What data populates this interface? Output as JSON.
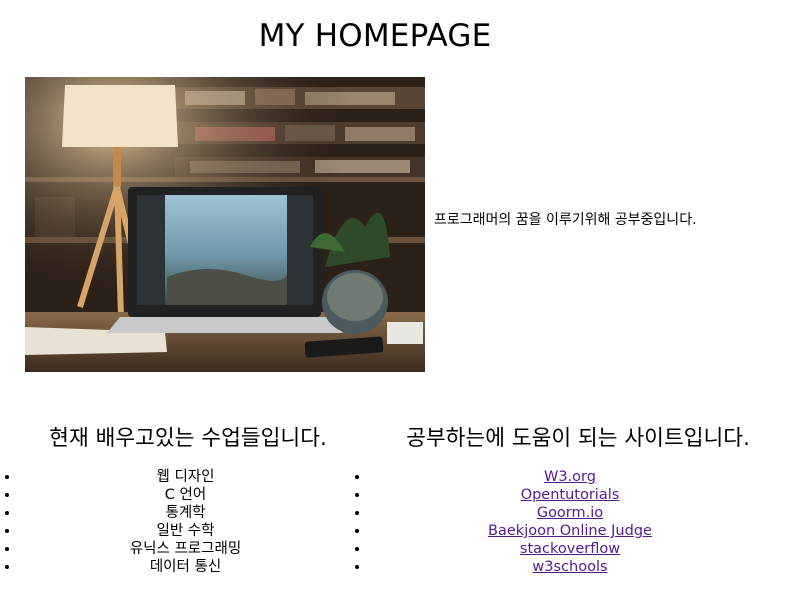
{
  "page": {
    "title": "MY HOMEPAGE"
  },
  "hero": {
    "intro_text": "프로그래머의 꿈을 이루기위해 공부중입니다."
  },
  "courses": {
    "heading": "현재 배우고있는 수업들입니다.",
    "items": [
      "웹 디자인",
      "C 언어",
      "통계학",
      "일반 수학",
      "유닉스 프로그래밍",
      "데이터 통신"
    ]
  },
  "sites": {
    "heading": "공부하는에 도움이 되는 사이트입니다.",
    "links": [
      "W3.org",
      "Opentutorials",
      "Goorm.io",
      "Baekjoon Online Judge",
      "stackoverflow",
      "w3schools"
    ]
  },
  "colors": {
    "visited_link": "#551a8b",
    "text": "#000000",
    "background": "#ffffff"
  }
}
